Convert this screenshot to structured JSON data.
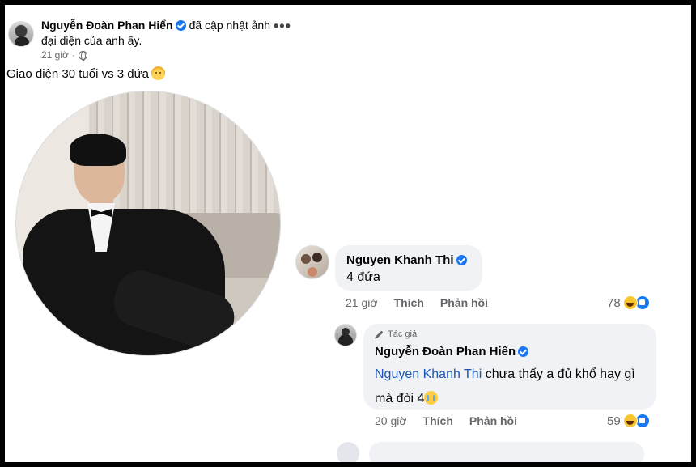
{
  "post": {
    "author": "Nguyễn Đoàn Phan Hiển",
    "action_line1": "đã cập nhật ảnh",
    "action_line2": "đại diện của anh ấy.",
    "time": "21 giờ",
    "separator": "·",
    "caption": "Giao diện 30 tuổi vs 3 đứa",
    "more_icon": "ellipsis-icon",
    "privacy_icon": "globe-icon"
  },
  "comments": [
    {
      "author": "Nguyen Khanh Thi",
      "text": "4 đứa",
      "time": "21 giờ",
      "like_label": "Thích",
      "reply_label": "Phản hồi",
      "reaction_count": "78",
      "reactions": [
        "haha-icon",
        "like-icon"
      ]
    },
    {
      "badge": "Tác giả",
      "author": "Nguyễn Đoàn Phan Hiển",
      "mention": "Nguyen Khanh Thi",
      "text": " chưa thấy a đủ khổ hay gì mà đòi 4",
      "time": "20 giờ",
      "like_label": "Thích",
      "reply_label": "Phản hồi",
      "reaction_count": "59",
      "reactions": [
        "haha-icon",
        "like-icon"
      ]
    }
  ],
  "colors": {
    "verified": "#1877f2",
    "mention": "#1a56b8",
    "bubble": "#f0f2f5",
    "meta_text": "#65676b"
  }
}
